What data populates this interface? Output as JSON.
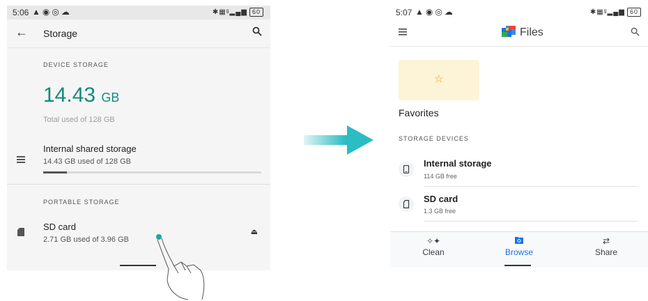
{
  "left": {
    "status": {
      "time": "5:06",
      "battery": "60"
    },
    "title": "Storage",
    "device_storage_header": "DEVICE STORAGE",
    "used_value": "14.43",
    "used_unit": "GB",
    "total_used": "Total used of 128 GB",
    "internal": {
      "title": "Internal shared storage",
      "subtitle": "14.43 GB used of 128 GB",
      "fill_fraction": 0.11
    },
    "portable_header": "PORTABLE STORAGE",
    "sd": {
      "title": "SD card",
      "subtitle": "2.71 GB used of 3.96 GB"
    }
  },
  "right": {
    "status": {
      "time": "5:07",
      "battery": "60"
    },
    "title": "Files",
    "favorites_label": "Favorites",
    "storage_devices_header": "STORAGE DEVICES",
    "devices": [
      {
        "title": "Internal storage",
        "subtitle": "114 GB free"
      },
      {
        "title": "SD card",
        "subtitle": "1.3 GB free"
      }
    ],
    "nav": [
      {
        "label": "Clean",
        "icon": "sparkle-icon"
      },
      {
        "label": "Browse",
        "icon": "browse-icon",
        "active": true
      },
      {
        "label": "Share",
        "icon": "swap-icon"
      }
    ]
  },
  "colors": {
    "accent_teal": "#128a7e",
    "files_blue": "#1a73e8",
    "favorites_bg": "#fdf3d6",
    "arrow": "#2bbcc4"
  }
}
